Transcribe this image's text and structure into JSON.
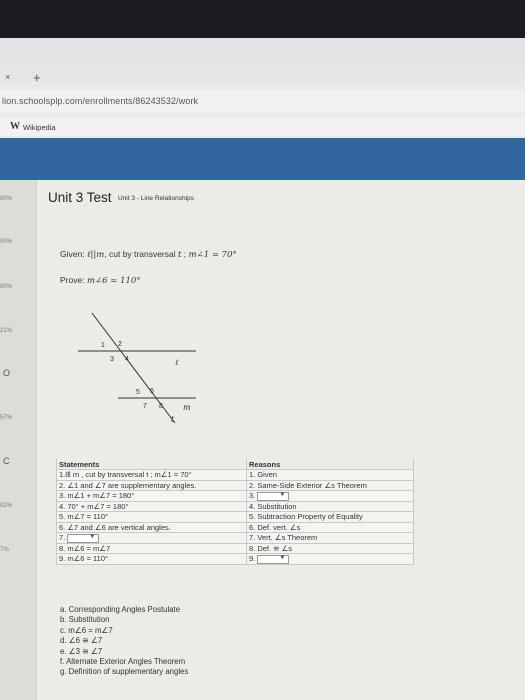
{
  "browser": {
    "tab_close": "×",
    "tab_new": "+",
    "url": "lion.schoolsplp.com/enrollments/86243532/work",
    "bookmark_icon": "W",
    "bookmark_label": "Wikipedia"
  },
  "sidebar": {
    "items": [
      "00%",
      "00%",
      "00%",
      "21%",
      "57%",
      "02%",
      "7%"
    ],
    "circles": [
      "O",
      "C"
    ]
  },
  "header": {
    "title": "Unit 3 Test",
    "subtitle": "Unit 3 - Line Relationships"
  },
  "problem": {
    "given_label": "Given:",
    "given_math": "ℓ||m",
    "given_text": ", cut by transversal",
    "given_t": "t",
    "given_sep": ";",
    "given_angle": "m∠1 = 70°",
    "prove_label": "Prove:",
    "prove_math": "m∠6 = 110°"
  },
  "diagram": {
    "angle_labels": [
      "1",
      "2",
      "3",
      "4",
      "5",
      "6",
      "7",
      "8"
    ],
    "line_l": "ℓ",
    "line_m": "m",
    "line_t": "t"
  },
  "proof": {
    "header_statements": "Statements",
    "header_reasons": "Reasons",
    "rows": [
      {
        "statement": "1.ℓ‖ m , cut by transversal t ; m∠1 = 70°",
        "reason": "1. Given",
        "s_dropdown": false,
        "r_dropdown": false
      },
      {
        "statement": "2. ∠1 and ∠7 are supplementary angles.",
        "reason": "2. Same-Side Exterior ∠s Theorem",
        "s_dropdown": false,
        "r_dropdown": false
      },
      {
        "statement": "3. m∠1 + m∠7 = 180°",
        "reason": "3.",
        "s_dropdown": false,
        "r_dropdown": true
      },
      {
        "statement": "4. 70° + m∠7 = 180°",
        "reason": "4. Substitution",
        "s_dropdown": false,
        "r_dropdown": false
      },
      {
        "statement": "5. m∠7 = 110°",
        "reason": "5. Subtraction Property of Equality",
        "s_dropdown": false,
        "r_dropdown": false
      },
      {
        "statement": "6. ∠7 and ∠6 are vertical angles.",
        "reason": "6. Def. vert. ∠s",
        "s_dropdown": false,
        "r_dropdown": false
      },
      {
        "statement": "7.",
        "reason": "7. Vert. ∠s Theorem",
        "s_dropdown": true,
        "r_dropdown": false
      },
      {
        "statement": "8. m∠6 = m∠7",
        "reason": "8. Def. ≅ ∠s",
        "s_dropdown": false,
        "r_dropdown": false
      },
      {
        "statement": "9. m∠6 = 110°",
        "reason": "9.",
        "s_dropdown": false,
        "r_dropdown": true
      }
    ],
    "dropdown_arrow": "▼"
  },
  "choices": [
    "a. Corresponding Angles Postulate",
    "b. Substitution",
    "c. m∠6 = m∠7",
    "d. ∠6 ≅ ∠7",
    "e. ∠3 ≅ ∠7",
    "f. Alternate Exterior Angles Theorem",
    "g. Definition of supplementary angles"
  ]
}
